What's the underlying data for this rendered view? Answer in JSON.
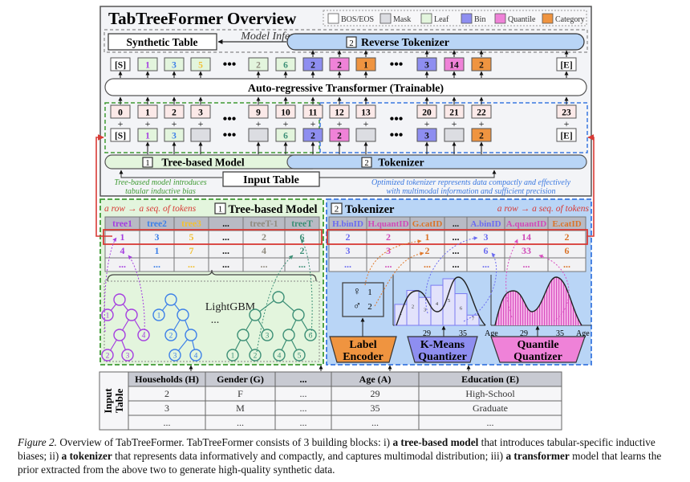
{
  "title": "TabTreeFormer Overview",
  "legend": [
    {
      "label": "BOS/EOS",
      "color": "#ffffff"
    },
    {
      "label": "Mask",
      "color": "#dcdde2"
    },
    {
      "label": "Leaf",
      "color": "#e3f5dd"
    },
    {
      "label": "Bin",
      "color": "#8e8ef0"
    },
    {
      "label": "Quantile",
      "color": "#ef82d8"
    },
    {
      "label": "Category",
      "color": "#ef9440"
    }
  ],
  "colors": {
    "leaf_bg": "#e3f5dd",
    "tokenizer_bg": "#b9d5f6",
    "green_dash": "#3f9a34",
    "blue_dash": "#3a78e0",
    "red": "#d83a35",
    "bin": "#8e8ef0",
    "quantile": "#ef82d8",
    "category": "#ef9440",
    "mask": "#dcdde2",
    "pos": "#fbe9e8",
    "tree1": "#a53ee0",
    "tree2": "#3d80e8",
    "tree3": "#f2c033",
    "treeT1": "#8f8a7e",
    "treeT": "#3c8f76"
  },
  "inference": {
    "label": "Model Inference",
    "synthetic_table": "Synthetic Table",
    "reverse_tokenizer_num": "2",
    "reverse_tokenizer": "Reverse Tokenizer"
  },
  "output_tokens": [
    {
      "text": "[S]",
      "kind": "bos"
    },
    {
      "text": "1",
      "kind": "leaf",
      "color": "tree1"
    },
    {
      "text": "3",
      "kind": "leaf",
      "color": "tree2"
    },
    {
      "text": "5",
      "kind": "leaf",
      "color": "tree3"
    },
    {
      "text": "...",
      "kind": "ellipsis"
    },
    {
      "text": "2",
      "kind": "leaf",
      "color": "treeT1"
    },
    {
      "text": "6",
      "kind": "leaf",
      "color": "treeT"
    },
    {
      "text": "2",
      "kind": "bin"
    },
    {
      "text": "2",
      "kind": "quantile"
    },
    {
      "text": "1",
      "kind": "category"
    },
    {
      "text": "...",
      "kind": "ellipsis"
    },
    {
      "text": "3",
      "kind": "bin"
    },
    {
      "text": "14",
      "kind": "quantile"
    },
    {
      "text": "2",
      "kind": "category"
    },
    {
      "text": "[E]",
      "kind": "bos"
    }
  ],
  "transformer": "Auto-regressive Transformer (Trainable)",
  "position_ids": [
    "0",
    "1",
    "2",
    "3",
    "...",
    "9",
    "10",
    "11",
    "12",
    "13",
    "...",
    "20",
    "21",
    "22",
    "23"
  ],
  "input_tokens": [
    {
      "text": "[S]",
      "kind": "bos"
    },
    {
      "text": "1",
      "kind": "leaf",
      "color": "tree1"
    },
    {
      "text": "3",
      "kind": "leaf",
      "color": "tree2"
    },
    {
      "text": "",
      "kind": "mask"
    },
    {
      "text": "...",
      "kind": "ellipsis"
    },
    {
      "text": "",
      "kind": "mask"
    },
    {
      "text": "6",
      "kind": "leaf",
      "color": "treeT"
    },
    {
      "text": "2",
      "kind": "bin"
    },
    {
      "text": "2",
      "kind": "quantile"
    },
    {
      "text": "",
      "kind": "mask"
    },
    {
      "text": "...",
      "kind": "ellipsis"
    },
    {
      "text": "3",
      "kind": "bin"
    },
    {
      "text": "",
      "kind": "mask"
    },
    {
      "text": "2",
      "kind": "category"
    },
    {
      "text": "[E]",
      "kind": "bos"
    }
  ],
  "plus": "+",
  "tree_model": {
    "num": "1",
    "label": "Tree-based Model"
  },
  "tokenizer": {
    "num": "2",
    "label": "Tokenizer"
  },
  "input_table_label": "Input Table",
  "note_left": [
    "Tree-based model introduces",
    "tabular inductive bias"
  ],
  "note_right": [
    "Optimized tokenizer represents data compactly and effectively",
    "with multimodal information and sufficient precision"
  ],
  "tree_panel": {
    "row_note": "a row → a seq. of tokens",
    "num": "1",
    "title": "Tree-based Model",
    "headers": [
      {
        "text": "tree1",
        "color": "tree1"
      },
      {
        "text": "tree2",
        "color": "tree2"
      },
      {
        "text": "tree3",
        "color": "tree3"
      },
      {
        "text": "...",
        "color": ""
      },
      {
        "text": "treeT-1",
        "color": "treeT1"
      },
      {
        "text": "treeT",
        "color": "treeT"
      }
    ],
    "rows": [
      [
        "1",
        "3",
        "5",
        "...",
        "2",
        "6"
      ],
      [
        "4",
        "1",
        "7",
        "...",
        "4",
        "2"
      ],
      [
        "...",
        "...",
        "...",
        "...",
        "...",
        "..."
      ]
    ],
    "model_label": "LightGBM",
    "model_ellipsis": "...",
    "tree_a_leaves": [
      "1",
      "4",
      "2",
      "3"
    ],
    "tree_b_leaves": [
      "1",
      "2",
      "3",
      "4"
    ],
    "tree_c_leaves": [
      "3",
      "6",
      "1",
      "2",
      "4",
      "5"
    ]
  },
  "tokenizer_panel": {
    "num": "2",
    "title": "Tokenizer",
    "row_note": "a row → a seq. of tokens",
    "headers": [
      {
        "text": "H.binID",
        "color": "bin_text"
      },
      {
        "text": "H.quantID",
        "color": "quant_text"
      },
      {
        "text": "G.catID",
        "color": "cat_text"
      },
      {
        "text": "...",
        "color": ""
      },
      {
        "text": "A.binID",
        "color": "bin_text"
      },
      {
        "text": "A.quantID",
        "color": "quant_text"
      },
      {
        "text": "E.catID",
        "color": "cat_text"
      }
    ],
    "rows": [
      [
        "2",
        "2",
        "1",
        "...",
        "3",
        "14",
        "2"
      ],
      [
        "3",
        "3",
        "2",
        "...",
        "6",
        "33",
        "6"
      ],
      [
        "...",
        "...",
        "...",
        "...",
        "...",
        "...",
        "..."
      ]
    ],
    "gender_map": [
      {
        "symbol": "♀",
        "id": "1"
      },
      {
        "symbol": "♂",
        "id": "2"
      }
    ],
    "kmeans_bins": [
      "1",
      "2",
      "3",
      "4",
      "5",
      "6",
      "7"
    ],
    "axis_ticks": [
      "29",
      "35"
    ],
    "axis_label": "Age",
    "label_encoder": [
      "Label",
      "Encoder"
    ],
    "kmeans": [
      "K-Means",
      "Quantizer"
    ],
    "quantile": [
      "Quantile",
      "Quantizer"
    ]
  },
  "input_table": {
    "side_label": [
      "Input",
      "Table"
    ],
    "headers": [
      "Households (H)",
      "Gender (G)",
      "...",
      "Age (A)",
      "Education (E)"
    ],
    "rows": [
      [
        "2",
        "F",
        "...",
        "29",
        "High-School"
      ],
      [
        "3",
        "M",
        "...",
        "35",
        "Graduate"
      ],
      [
        "...",
        "...",
        "...",
        "...",
        "..."
      ]
    ]
  },
  "caption": {
    "fig": "Figure 2.",
    "t1": " Overview of TabTreeFormer. TabTreeFormer consists of 3 building blocks: i) ",
    "b1": "a tree-based model",
    "t2": " that introduces tabular-specific inductive biases; ii) ",
    "b2": "a tokenizer",
    "t3": " that represents data informatively and compactly, and captures multimodal distribution; iii) ",
    "b3": "a transformer",
    "t4": " model that learns the prior extracted from the above two to generate high-quality synthetic data."
  }
}
